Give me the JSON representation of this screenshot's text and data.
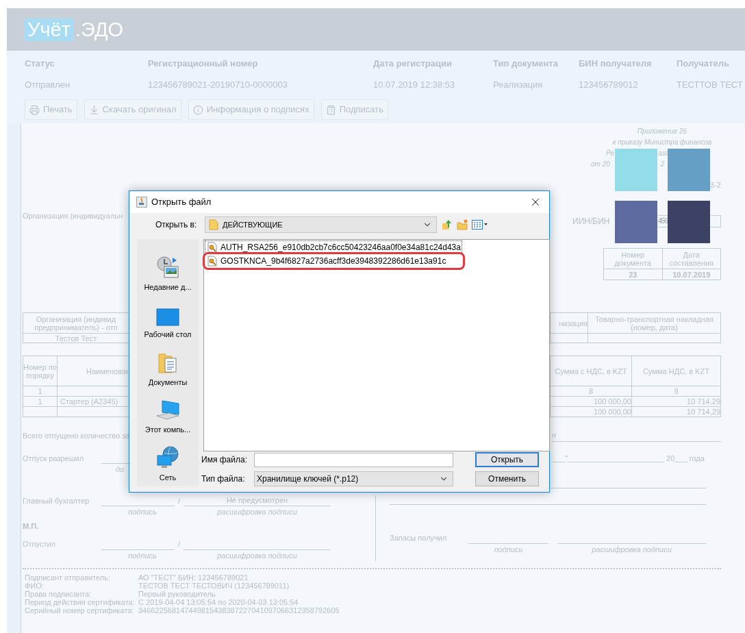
{
  "app": {
    "logo_highlight": "Учёт",
    "logo_rest": ".ЭДО"
  },
  "summary": [
    {
      "label": "Статус",
      "value": "Отправлен"
    },
    {
      "label": "Регистрационный номер",
      "value": "123456789021-20190710-0000003"
    },
    {
      "label": "Дата регистрации",
      "value": "10.07.2019 12:38:53"
    },
    {
      "label": "Тип документа",
      "value": "Реализация"
    },
    {
      "label": "БИН получателя",
      "value": "123456789012"
    },
    {
      "label": "Получатель",
      "value": "ТЕСТТОВ ТЕСТ"
    }
  ],
  "toolbar": [
    {
      "kind": "print",
      "label": "Печать"
    },
    {
      "kind": "download",
      "label": "Скачать оригинал"
    },
    {
      "kind": "info",
      "label": "Информация о подписях"
    },
    {
      "kind": "sign",
      "label": "Подписать"
    }
  ],
  "document": {
    "appendix": [
      "Приложение 26",
      "к приказу Министра финансов"
    ],
    "appendix_fragments": [
      [
        "Ре",
        "аза"
      ],
      [
        "от 20",
        "2"
      ]
    ],
    "form_code": "3-2",
    "org_label": "Организация (индивидуальн",
    "iin_label": "ИИН/БИН",
    "iin_value": "456",
    "doc_table": {
      "headers": [
        "Номер документа",
        "Дата составления"
      ],
      "values": [
        "23",
        "10.07.2019"
      ]
    },
    "parties": {
      "headers": [
        "Организация (индивид предприниматель) - отп",
        "низация",
        "Товарно-транспортная накладная (номер, дата)"
      ],
      "values": [
        "Тестов Тест"
      ]
    },
    "items": {
      "headers": [
        "Номер по порядку",
        "Наименован",
        "Сумма с НДС, в KZT",
        "Сумма НДС, в KZT"
      ],
      "rows": [
        [
          "1",
          "",
          "8",
          "9"
        ],
        [
          "1",
          "Стартер (А2345)",
          "100 000,00",
          "10 714,29"
        ],
        [
          "",
          "",
          "100 000,00",
          "10 714,29"
        ]
      ]
    },
    "total_label": "Всего отпущено количество за",
    "total_fragment": "н",
    "release_label": "Отпуск разрешил",
    "release_caption": "до",
    "date_line": "___\"_______________________ 20___ года",
    "accountant_label": "Главный бухгалтер",
    "accountant_slash": "/",
    "accountant_value": "Не предусмотрен",
    "accountant_captions": [
      "подпись",
      "расшифровка подписи"
    ],
    "stamp": "М.П.",
    "issued_label": "Отпустил",
    "issued_slash": "/",
    "issued_captions": [
      "подпись",
      "расшифровка подписи"
    ],
    "received_label": "Запасы получил",
    "received_captions": [
      "подпись",
      "расшифровка подписи"
    ],
    "signer": [
      {
        "label": "Подписант отправитель:",
        "value": "АО \"ТЕСТ\" БИН: 123456789021"
      },
      {
        "label": "ФИО:",
        "value": "ТЕСТОВ ТЕСТ ТЕСТОВИЧ (123456789011)"
      },
      {
        "label": "Права подписанта:",
        "value": "Первый руководитель"
      },
      {
        "label": "Период действия сертификата:",
        "value": "С 2019-04-04 13:05:54 по 2020-04-03 13:05:54"
      },
      {
        "label": "Серийный номер сертификата:",
        "value": "346622568147449815438387227041097066312358792605"
      }
    ]
  },
  "swatches": [
    {
      "color": "#93dce9"
    },
    {
      "color": "#679ec5"
    },
    {
      "color": "#5d6ba0"
    },
    {
      "color": "#3b4265"
    }
  ],
  "dialog": {
    "title": "Открыть файл",
    "look_in_label": "Открыть в:",
    "folder": "ДЕЙСТВУЮЩИЕ",
    "places": [
      {
        "kind": "recent",
        "label": "Недавние д..."
      },
      {
        "kind": "desktop",
        "label": "Рабочий стол"
      },
      {
        "kind": "documents",
        "label": "Документы"
      },
      {
        "kind": "computer",
        "label": "Этот компь..."
      },
      {
        "kind": "network",
        "label": "Сеть"
      }
    ],
    "files": [
      {
        "name": "AUTH_RSA256_e910db2cb7c6cc50423246aa0f0e34a81c24d43a",
        "focused": true,
        "highlighted": false
      },
      {
        "name": "GOSTKNCA_9b4f6827a2736acff3de3948392286d61e13a91c",
        "focused": false,
        "highlighted": true
      }
    ],
    "filename_label": "Имя файла:",
    "filetype_label": "Тип файла:",
    "filetype": "Хранилище ключей (*.p12)",
    "open_button": "Открыть",
    "cancel_button": "Отменить"
  }
}
